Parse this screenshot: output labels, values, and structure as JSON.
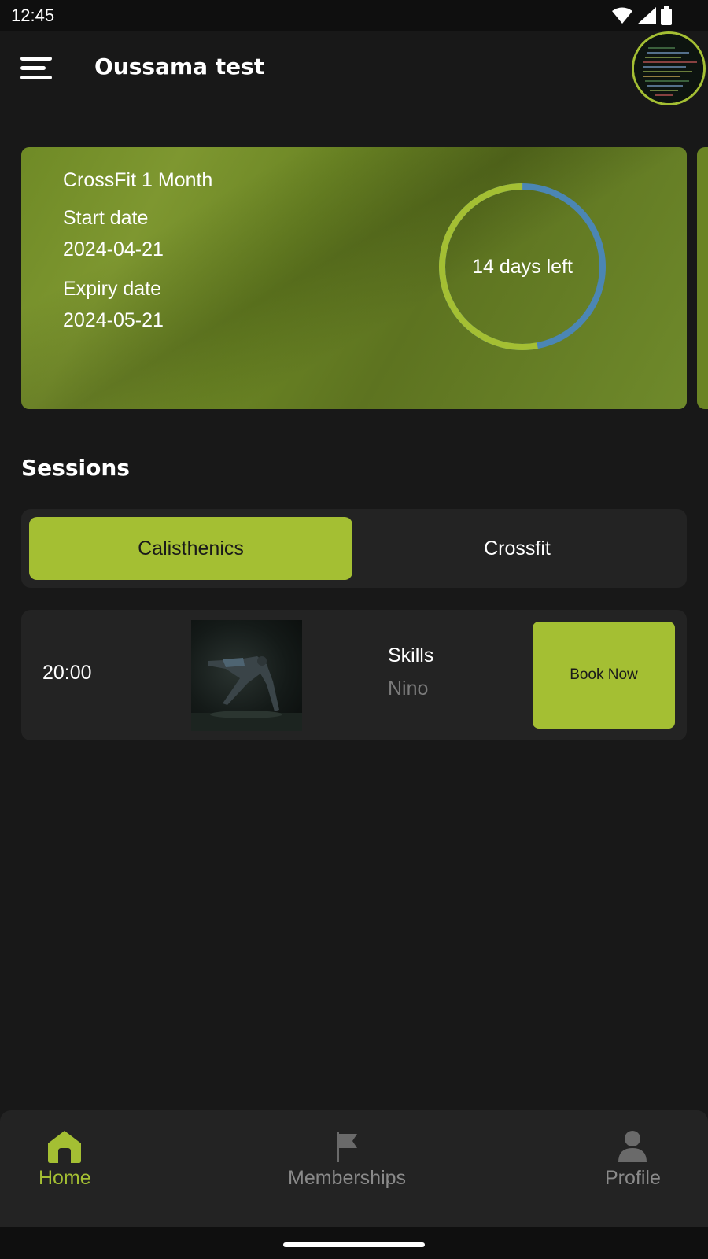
{
  "status_bar": {
    "time": "12:45"
  },
  "header": {
    "title": "Oussama test"
  },
  "membership": {
    "plan": "CrossFit 1 Month",
    "start_label": "Start date",
    "start_date": "2024-04-21",
    "expiry_label": "Expiry date",
    "expiry_date": "2024-05-21",
    "days_left_label": "14 days left",
    "progress_fraction": 0.53
  },
  "sessions": {
    "title": "Sessions",
    "tabs": [
      {
        "label": "Calisthenics",
        "active": true
      },
      {
        "label": "Crossfit",
        "active": false
      }
    ],
    "items": [
      {
        "time": "20:00",
        "name": "Skills",
        "coach": "Nino",
        "button_label": "Book Now"
      }
    ]
  },
  "bottom_nav": {
    "items": [
      {
        "label": "Home",
        "icon": "home-icon",
        "active": true
      },
      {
        "label": "Memberships",
        "icon": "flag-icon",
        "active": false
      },
      {
        "label": "Profile",
        "icon": "person-icon",
        "active": false
      }
    ]
  },
  "colors": {
    "accent": "#a4bf33",
    "background": "#181818",
    "surface": "#232323",
    "ring_remaining": "#4b86b4"
  }
}
